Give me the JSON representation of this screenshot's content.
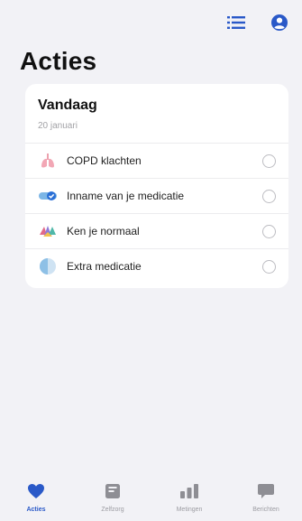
{
  "header": {
    "title": "Acties",
    "list_icon": "list-icon",
    "profile_icon": "profile-icon"
  },
  "colors": {
    "accent": "#2a59c8",
    "background": "#f2f2f6",
    "card": "#ffffff"
  },
  "today_card": {
    "title": "Vandaag",
    "date": "20 januari",
    "items": [
      {
        "label": "COPD klachten",
        "icon": "lungs-icon",
        "done": false
      },
      {
        "label": "Inname van je medicatie",
        "icon": "pill-icon",
        "done": false
      },
      {
        "label": "Ken je normaal",
        "icon": "hands-icon",
        "done": false
      },
      {
        "label": "Extra medicatie",
        "icon": "half-circle-icon",
        "done": false
      }
    ]
  },
  "tab_bar": {
    "tabs": [
      {
        "label": "Acties",
        "icon": "heart-icon",
        "active": true
      },
      {
        "label": "Zelfzorg",
        "icon": "notebook-icon",
        "active": false
      },
      {
        "label": "Metingen",
        "icon": "bar-chart-icon",
        "active": false
      },
      {
        "label": "Berichten",
        "icon": "message-icon",
        "active": false
      }
    ]
  }
}
